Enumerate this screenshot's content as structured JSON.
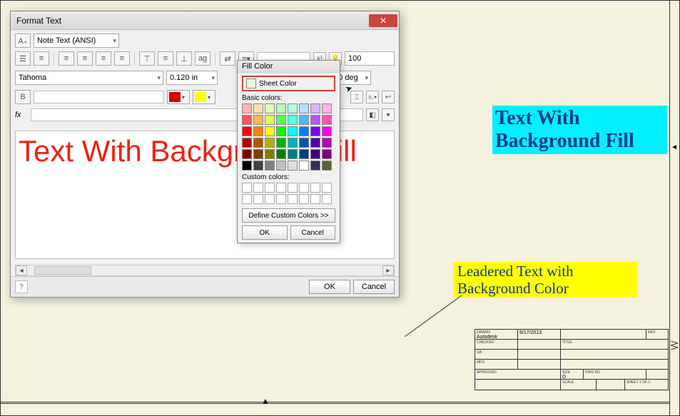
{
  "dialog": {
    "title": "Format Text",
    "style_combo": "Note Text (ANSI)",
    "font_combo": "Tahoma",
    "size_input": "0.120 in",
    "stretch_input": "100",
    "rotate_input": "0.0 deg",
    "fx_label": "fx",
    "preview_text": "Text With Background Fill",
    "ok": "OK",
    "cancel": "Cancel"
  },
  "popup": {
    "title": "Fill Color",
    "sheet_color_label": "Sheet Color",
    "basic_label": "Basic colors:",
    "custom_label": "Custom colors:",
    "define_label": "Define Custom Colors >>",
    "ok": "OK",
    "cancel": "Cancel",
    "basic_colors": [
      "#ffb4b4",
      "#ffe0b4",
      "#e0ffb4",
      "#b4ffb4",
      "#b4ffe0",
      "#b4e0ff",
      "#e0b4ff",
      "#ffb4e0",
      "#ff5555",
      "#ffb455",
      "#e0ff55",
      "#55ff55",
      "#55ffe0",
      "#55b4ff",
      "#b455ff",
      "#ff55b4",
      "#ff0000",
      "#ff8000",
      "#ffff00",
      "#00ff00",
      "#00ffff",
      "#0080ff",
      "#8000ff",
      "#ff00ff",
      "#b40000",
      "#b45500",
      "#b4b400",
      "#00b400",
      "#00b4b4",
      "#0055b4",
      "#5500b4",
      "#b400b4",
      "#800000",
      "#804000",
      "#808000",
      "#008000",
      "#008080",
      "#004080",
      "#400080",
      "#800080",
      "#000000",
      "#404040",
      "#808080",
      "#c0c0c0",
      "#e0e0e0",
      "#ffffff",
      "#303060",
      "#606030"
    ]
  },
  "canvas": {
    "text1": "Text With Background Fill",
    "text2": "Leadered Text with Background Color"
  },
  "titleblock": {
    "drawn_label": "DRAWN",
    "drawn_val": "Autodesk",
    "date": "9/17/2013",
    "checked_label": "CHECKED",
    "qa_label": "QA",
    "mfg_label": "MFG",
    "approved_label": "APPROVED",
    "title_label": "TITLE",
    "rev_label": "REV",
    "size_label": "SIZE",
    "size_val": "D",
    "dwgno_label": "DWG NO",
    "scale_label": "SCALE",
    "sheet_label": "SHEET 1 OF 1"
  }
}
